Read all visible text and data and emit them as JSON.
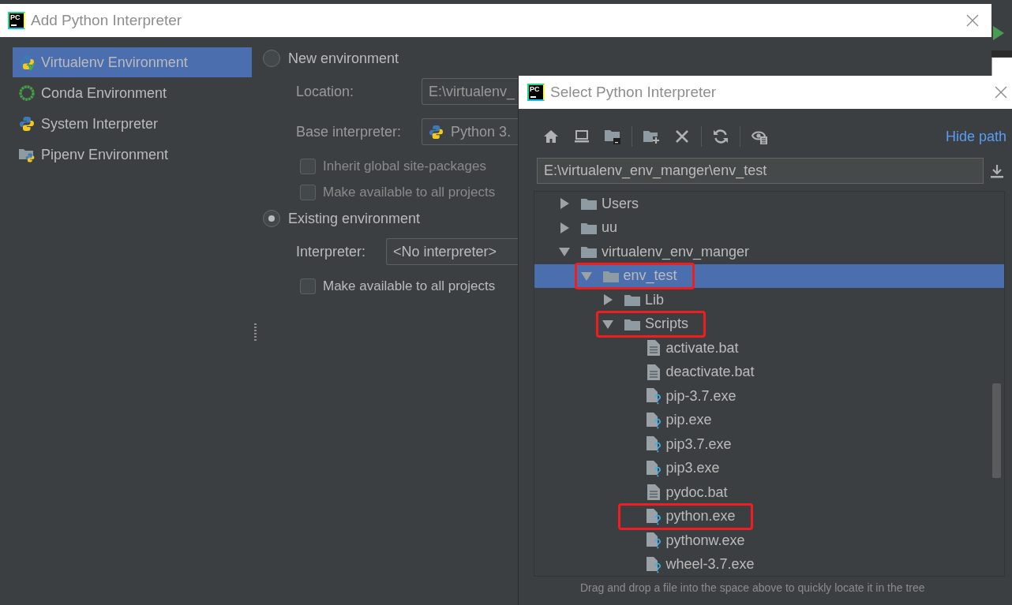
{
  "add_dialog": {
    "logo": "PC",
    "title": "Add Python Interpreter",
    "sidebar": [
      {
        "label": "Virtualenv Environment",
        "kind": "virtualenv",
        "selected": true
      },
      {
        "label": "Conda Environment",
        "kind": "conda",
        "selected": false
      },
      {
        "label": "System Interpreter",
        "kind": "system",
        "selected": false
      },
      {
        "label": "Pipenv Environment",
        "kind": "pipenv",
        "selected": false
      }
    ],
    "options": [
      {
        "label": "New environment",
        "selected": false,
        "fields": [
          {
            "label": "Location:",
            "kind": "text",
            "value": "E:\\virtualenv_"
          },
          {
            "label": "Base interpreter:",
            "kind": "python_combo",
            "value": "Python 3."
          }
        ],
        "checkboxes": [
          {
            "label": "Inherit global site-packages",
            "checked": false
          },
          {
            "label": "Make available to all projects",
            "checked": false
          }
        ]
      },
      {
        "label": "Existing environment",
        "selected": true,
        "fields": [
          {
            "label": "Interpreter:",
            "kind": "combo",
            "value": "<No interpreter>"
          }
        ],
        "checkboxes": [
          {
            "label": "Make available to all projects",
            "checked": false
          }
        ]
      }
    ]
  },
  "select_dialog": {
    "logo": "PC",
    "title": "Select Python Interpreter",
    "hide_path_link": "Hide path",
    "path": "E:\\virtualenv_env_manger\\env_test",
    "tree": [
      {
        "name": "Users",
        "kind": "folder",
        "expanded": false,
        "selected": false,
        "highlighted": false
      },
      {
        "name": "uu",
        "kind": "folder",
        "expanded": false,
        "selected": false,
        "highlighted": false
      },
      {
        "name": "virtualenv_env_manger",
        "kind": "folder",
        "expanded": true,
        "selected": false,
        "highlighted": false,
        "children": [
          {
            "name": "env_test",
            "kind": "folder",
            "expanded": true,
            "selected": true,
            "highlighted": true,
            "children": [
              {
                "name": "Lib",
                "kind": "folder",
                "expanded": false,
                "selected": false,
                "highlighted": false
              },
              {
                "name": "Scripts",
                "kind": "folder",
                "expanded": true,
                "selected": false,
                "highlighted": true,
                "children": [
                  {
                    "name": "activate.bat",
                    "kind": "script",
                    "selected": false,
                    "highlighted": false
                  },
                  {
                    "name": "deactivate.bat",
                    "kind": "script",
                    "selected": false,
                    "highlighted": false
                  },
                  {
                    "name": "pip-3.7.exe",
                    "kind": "unknown",
                    "selected": false,
                    "highlighted": false
                  },
                  {
                    "name": "pip.exe",
                    "kind": "unknown",
                    "selected": false,
                    "highlighted": false
                  },
                  {
                    "name": "pip3.7.exe",
                    "kind": "unknown",
                    "selected": false,
                    "highlighted": false
                  },
                  {
                    "name": "pip3.exe",
                    "kind": "unknown",
                    "selected": false,
                    "highlighted": false
                  },
                  {
                    "name": "pydoc.bat",
                    "kind": "script",
                    "selected": false,
                    "highlighted": false
                  },
                  {
                    "name": "python.exe",
                    "kind": "unknown",
                    "selected": false,
                    "highlighted": true
                  },
                  {
                    "name": "pythonw.exe",
                    "kind": "unknown",
                    "selected": false,
                    "highlighted": false
                  },
                  {
                    "name": "wheel-3.7.exe",
                    "kind": "unknown",
                    "selected": false,
                    "highlighted": false
                  }
                ]
              }
            ]
          }
        ]
      }
    ],
    "hint": "Drag and drop a file into the space above to quickly locate it in the tree"
  }
}
